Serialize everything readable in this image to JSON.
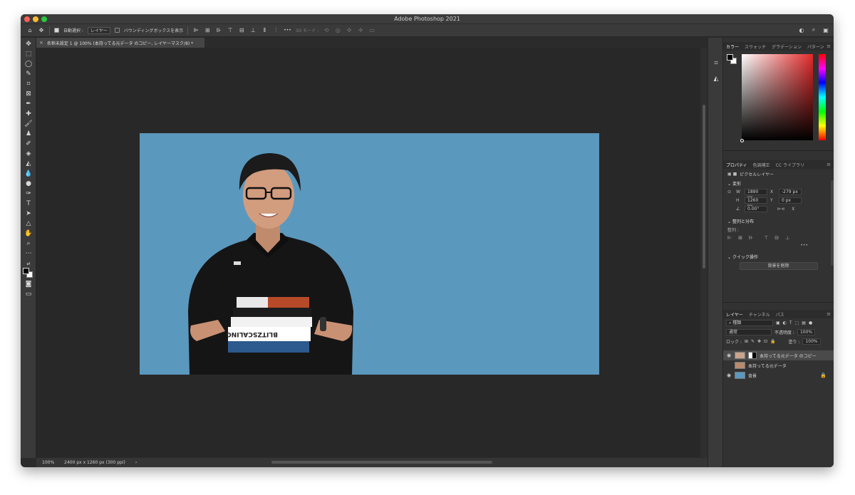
{
  "window": {
    "title": "Adobe Photoshop 2021"
  },
  "options_bar": {
    "auto_select_label": "自動選択 :",
    "auto_select_value": "レイヤー",
    "show_transform_label": "バウンディングボックスを表示",
    "more": "•••",
    "mode_3d": "3D モード :"
  },
  "document": {
    "tab_title": "名称未設定 1 @ 100% (本持ってる元データ のコピー, レイヤーマスク/8) *",
    "zoom": "100%",
    "doc_info": "2400 px x 1260 px (300 ppi)",
    "canvas_color": "#5b98bd"
  },
  "color_panel": {
    "tabs": [
      "カラー",
      "スウォッチ",
      "グラデーション",
      "パターン"
    ]
  },
  "properties_panel": {
    "tabs": [
      "プロパティ",
      "色調補正",
      "CC ライブラリ"
    ],
    "layer_type": "ピクセルレイヤー",
    "transform": {
      "header": "変形",
      "w_label": "W",
      "w": "1890 px",
      "x_label": "X",
      "x": "-279 px",
      "h_label": "H",
      "h": "1260 px",
      "y_label": "Y",
      "y": "0 px",
      "angle": "0.00°"
    },
    "align": {
      "header": "整列と分布",
      "label": "整列 :",
      "more": "•••"
    },
    "quick": {
      "header": "クイック操作",
      "remove_bg": "背景を削除"
    }
  },
  "layers_panel": {
    "tabs": [
      "レイヤー",
      "チャンネル",
      "パス"
    ],
    "filter_kind": "種類",
    "blend_mode": "通常",
    "opacity_label": "不透明度 :",
    "opacity": "100%",
    "lock_label": "ロック :",
    "fill_label": "塗り :",
    "fill": "100%",
    "layers": [
      {
        "name": "本持ってる元データ のコピー",
        "visible": true,
        "selected": true
      },
      {
        "name": "本持ってる元データ",
        "visible": false,
        "selected": false
      },
      {
        "name": "背景",
        "visible": true,
        "selected": false
      }
    ]
  },
  "photo": {
    "book_title": "BLITZSCALING"
  }
}
